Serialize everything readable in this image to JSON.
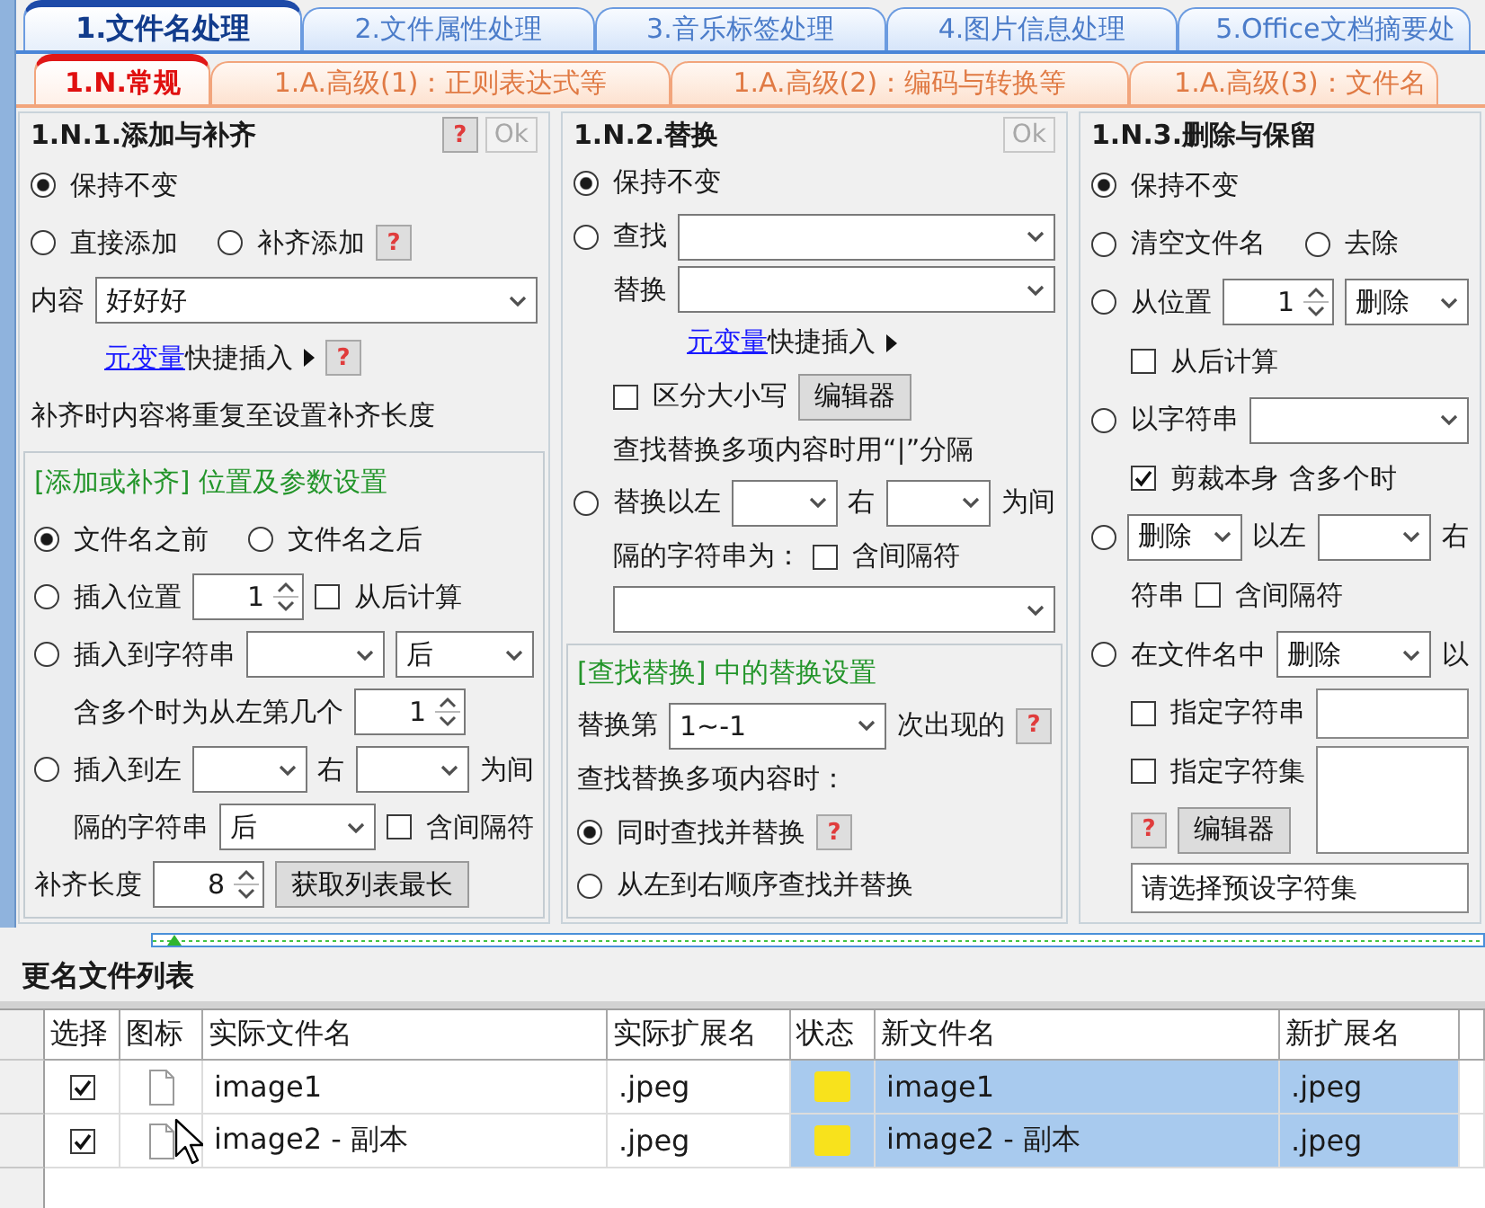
{
  "main_tabs": [
    {
      "label": "1.文件名处理",
      "selected": true
    },
    {
      "label": "2.文件属性处理",
      "selected": false
    },
    {
      "label": "3.音乐标签处理",
      "selected": false
    },
    {
      "label": "4.图片信息处理",
      "selected": false
    },
    {
      "label": "5.Office文档摘要处",
      "selected": false
    }
  ],
  "sub_tabs": [
    {
      "label": "1.N.常规",
      "selected": true
    },
    {
      "label": "1.A.高级(1)：正则表达式等",
      "selected": false
    },
    {
      "label": "1.A.高级(2)：编码与转换等",
      "selected": false
    },
    {
      "label": "1.A.高级(3)：文件名",
      "selected": false
    }
  ],
  "panels": [
    {
      "title": "1.N.1.添加与补齐",
      "header_buttons": [
        {
          "kind": "help",
          "label": "?"
        },
        {
          "kind": "button",
          "label": "Ok",
          "disabled": true
        }
      ],
      "rows": [
        {
          "items": [
            {
              "kind": "radio",
              "label": "保持不变",
              "selected": true
            }
          ]
        },
        {
          "items": [
            {
              "kind": "radio",
              "label": "直接添加",
              "selected": false
            },
            {
              "kind": "radio",
              "label": "补齐添加",
              "selected": false
            },
            {
              "kind": "help",
              "label": "?"
            }
          ]
        },
        {
          "items": [
            {
              "kind": "text",
              "text": "内容"
            },
            {
              "kind": "combo",
              "value": "好好好"
            }
          ],
          "children": [
            {
              "items": [
                {
                  "kind": "link",
                  "text": "元变量"
                },
                {
                  "kind": "text",
                  "text": "快捷插入"
                },
                {
                  "kind": "arrow"
                },
                {
                  "kind": "help",
                  "label": "?"
                }
              ]
            }
          ]
        },
        {
          "items": [
            {
              "kind": "text",
              "text": "补齐时内容将重复至设置补齐长度"
            }
          ]
        }
      ],
      "group": {
        "title": "[添加或补齐] 位置及参数设置",
        "rows": [
          {
            "items": [
              {
                "kind": "radio",
                "label": "文件名之前",
                "selected": true
              },
              {
                "kind": "radio",
                "label": "文件名之后",
                "selected": false
              }
            ]
          },
          {
            "items": [
              {
                "kind": "radio",
                "label": "插入位置",
                "selected": false
              },
              {
                "kind": "spin",
                "value": "1"
              },
              {
                "kind": "checkbox",
                "label": "从后计算",
                "checked": false
              }
            ]
          },
          {
            "items": [
              {
                "kind": "radio",
                "label": "插入到字符串",
                "selected": false
              },
              {
                "kind": "combo"
              },
              {
                "kind": "combo",
                "value": "后"
              }
            ],
            "children": [
              {
                "items": [
                  {
                    "kind": "text",
                    "text": "含多个时为从左第几个"
                  },
                  {
                    "kind": "spin",
                    "value": "1"
                  }
                ]
              }
            ]
          },
          {
            "items": [
              {
                "kind": "radio",
                "label": "插入到左",
                "selected": false
              },
              {
                "kind": "combo"
              },
              {
                "kind": "text",
                "text": "右"
              },
              {
                "kind": "combo"
              },
              {
                "kind": "text",
                "text": "为间"
              }
            ],
            "children": [
              {
                "items": [
                  {
                    "kind": "text",
                    "text": "隔的字符串"
                  },
                  {
                    "kind": "combo",
                    "value": "后"
                  },
                  {
                    "kind": "checkbox",
                    "label": "含间隔符",
                    "checked": false
                  }
                ]
              }
            ]
          },
          {
            "items": [
              {
                "kind": "text",
                "text": "补齐长度"
              },
              {
                "kind": "spin",
                "value": "8"
              },
              {
                "kind": "button",
                "label": "获取列表最长"
              }
            ]
          }
        ]
      }
    },
    {
      "title": "1.N.2.替换",
      "header_buttons": [
        {
          "kind": "button",
          "label": "Ok",
          "disabled": true
        }
      ],
      "rows": [
        {
          "items": [
            {
              "kind": "radio",
              "label": "保持不变",
              "selected": true
            }
          ]
        },
        {
          "items": [
            {
              "kind": "radio",
              "label": "查找",
              "selected": false
            },
            {
              "kind": "combo"
            }
          ],
          "children": [
            {
              "items": [
                {
                  "kind": "text",
                  "text": "替换"
                },
                {
                  "kind": "combo"
                }
              ],
              "children": [
                {
                  "items": [
                    {
                      "kind": "link",
                      "text": "元变量"
                    },
                    {
                      "kind": "text",
                      "text": "快捷插入"
                    },
                    {
                      "kind": "arrow"
                    }
                  ]
                }
              ]
            },
            {
              "items": [
                {
                  "kind": "checkbox",
                  "label": "区分大小写",
                  "checked": false
                },
                {
                  "kind": "button",
                  "label": "编辑器"
                }
              ]
            },
            {
              "items": [
                {
                  "kind": "text",
                  "text": "查找替换多项内容时用“|”分隔"
                }
              ]
            }
          ]
        },
        {
          "items": [
            {
              "kind": "radio",
              "label": "替换以左",
              "selected": false
            },
            {
              "kind": "combo"
            },
            {
              "kind": "text",
              "text": "右"
            },
            {
              "kind": "combo"
            },
            {
              "kind": "text",
              "text": "为间"
            }
          ],
          "children": [
            {
              "items": [
                {
                  "kind": "text",
                  "text": "隔的字符串为："
                },
                {
                  "kind": "checkbox",
                  "label": "含间隔符",
                  "checked": false
                }
              ]
            },
            {
              "items": [
                {
                  "kind": "combo"
                }
              ]
            }
          ]
        }
      ],
      "group": {
        "title": "[查找替换] 中的替换设置",
        "rows": [
          {
            "items": [
              {
                "kind": "text",
                "text": "替换第"
              },
              {
                "kind": "combo",
                "value": "1~-1"
              },
              {
                "kind": "text",
                "text": "次出现的"
              },
              {
                "kind": "help",
                "label": "?"
              }
            ]
          },
          {
            "items": [
              {
                "kind": "text",
                "text": "查找替换多项内容时："
              }
            ]
          },
          {
            "items": [
              {
                "kind": "radio",
                "label": "同时查找并替换",
                "selected": true
              },
              {
                "kind": "help",
                "label": "?"
              }
            ]
          },
          {
            "items": [
              {
                "kind": "radio",
                "label": "从左到右顺序查找并替换",
                "selected": false
              }
            ]
          }
        ]
      }
    },
    {
      "title": "1.N.3.删除与保留",
      "rows": [
        {
          "items": [
            {
              "kind": "radio",
              "label": "保持不变",
              "selected": true
            }
          ]
        },
        {
          "items": [
            {
              "kind": "radio",
              "label": "清空文件名",
              "selected": false
            },
            {
              "kind": "radio",
              "label": "去除",
              "selected": false
            }
          ]
        },
        {
          "items": [
            {
              "kind": "radio",
              "label": "从位置",
              "selected": false
            },
            {
              "kind": "spin",
              "value": "1"
            },
            {
              "kind": "combo",
              "value": "删除"
            }
          ],
          "children": [
            {
              "items": [
                {
                  "kind": "checkbox",
                  "label": "从后计算",
                  "checked": false
                }
              ]
            }
          ]
        },
        {
          "items": [
            {
              "kind": "radio",
              "label": "以字符串",
              "selected": false
            },
            {
              "kind": "combo"
            }
          ],
          "children": [
            {
              "items": [
                {
                  "kind": "checkbox",
                  "label": "剪裁本身",
                  "checked": true
                },
                {
                  "kind": "text",
                  "text": "含多个时"
                }
              ]
            }
          ]
        },
        {
          "items": [
            {
              "kind": "radio",
              "selected": false
            },
            {
              "kind": "combo",
              "value": "删除"
            },
            {
              "kind": "text",
              "text": "以左"
            },
            {
              "kind": "combo"
            },
            {
              "kind": "text",
              "text": "右"
            }
          ],
          "children": [
            {
              "items": [
                {
                  "kind": "text",
                  "text": "符串"
                },
                {
                  "kind": "checkbox",
                  "label": "含间隔符",
                  "checked": false
                }
              ]
            }
          ]
        },
        {
          "items": [
            {
              "kind": "radio",
              "label": "在文件名中",
              "selected": false
            },
            {
              "kind": "combo",
              "value": "删除"
            },
            {
              "kind": "text",
              "text": "以"
            }
          ],
          "children": [
            {
              "items": [
                {
                  "kind": "checkbox",
                  "label": "指定字符串",
                  "checked": false
                },
                {
                  "kind": "field"
                }
              ]
            },
            {
              "items": [
                {
                  "kind": "checkbox",
                  "label": "指定字符集",
                  "checked": false
                },
                {
                  "kind": "memo"
                }
              ]
            },
            {
              "items": [
                {
                  "kind": "help",
                  "label": "?"
                },
                {
                  "kind": "button",
                  "label": "编辑器"
                }
              ]
            },
            {
              "items": [
                {
                  "kind": "field",
                  "value": "请选择预设字符集"
                }
              ]
            }
          ]
        }
      ]
    }
  ],
  "file_list": {
    "title": "更名文件列表",
    "columns": [
      {
        "label": "选择",
        "highlighted": false
      },
      {
        "label": "图标",
        "highlighted": false
      },
      {
        "label": "实际文件名",
        "highlighted": false
      },
      {
        "label": "实际扩展名",
        "highlighted": false
      },
      {
        "label": "状态",
        "highlighted": true
      },
      {
        "label": "新文件名",
        "highlighted": true
      },
      {
        "label": "新扩展名",
        "highlighted": true
      }
    ],
    "rows": [
      {
        "checked": true,
        "name": "image1",
        "ext": ".jpeg",
        "status": {
          "color": "#f8e21c"
        },
        "new_name": "image1",
        "new_ext": ".jpeg"
      },
      {
        "checked": true,
        "name": "image2 - 副本",
        "ext": ".jpeg",
        "status": {
          "color": "#f8e21c"
        },
        "new_name": "image2 - 副本",
        "new_ext": ".jpeg"
      }
    ]
  }
}
